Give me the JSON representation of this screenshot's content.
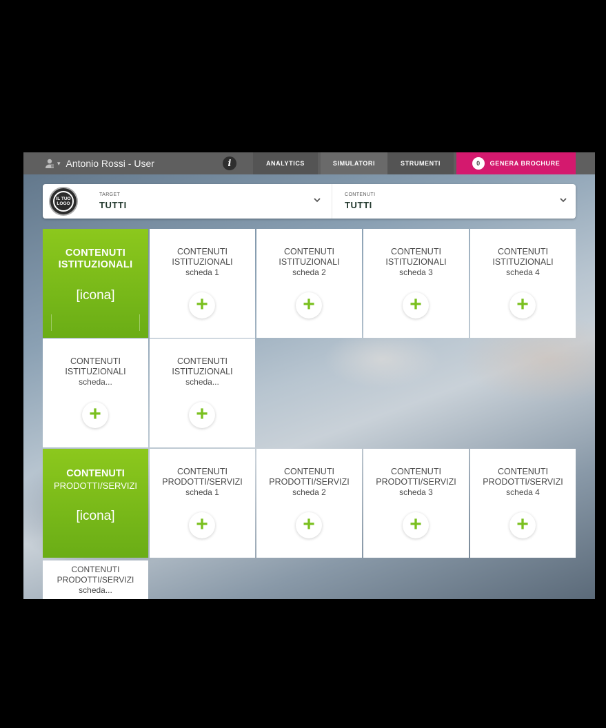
{
  "header": {
    "user_name": "Antonio Rossi - User",
    "user_caret": "▾",
    "info_icon": "i",
    "tabs": {
      "analytics": "ANALYTICS",
      "simulatori": "SIMULATORI",
      "strumenti": "STRUMENTI",
      "brochure": "GENERA BROCHURE"
    },
    "brochure_count": "0",
    "brochure_color": "#d4196e"
  },
  "filters": {
    "logo_line1": "IL TUO",
    "logo_line2": "LOGO",
    "target_label": "TARGET",
    "target_value": "TUTTI",
    "contenuti_label": "CONTENUTI",
    "contenuti_value": "TUTTI"
  },
  "sections": {
    "istituzionali": {
      "title_line1": "CONTENUTI",
      "title_line2": "ISTITUZIONALI",
      "icon_placeholder": "[icona]",
      "cards": [
        {
          "line1": "CONTENUTI",
          "line2": "ISTITUZIONALI",
          "line3": "scheda 1"
        },
        {
          "line1": "CONTENUTI",
          "line2": "ISTITUZIONALI",
          "line3": "scheda 2"
        },
        {
          "line1": "CONTENUTI",
          "line2": "ISTITUZIONALI",
          "line3": "scheda 3"
        },
        {
          "line1": "CONTENUTI",
          "line2": "ISTITUZIONALI",
          "line3": "scheda 4"
        },
        {
          "line1": "CONTENUTI",
          "line2": "ISTITUZIONALI",
          "line3": "scheda..."
        },
        {
          "line1": "CONTENUTI",
          "line2": "ISTITUZIONALI",
          "line3": "scheda..."
        }
      ]
    },
    "prodotti": {
      "title_line1": "CONTENUTI",
      "title_line2": "PRODOTTI/SERVIZI",
      "icon_placeholder": "[icona]",
      "cards": [
        {
          "line1": "CONTENUTI",
          "line2": "PRODOTTI/SERVIZI",
          "line3": "scheda 1"
        },
        {
          "line1": "CONTENUTI",
          "line2": "PRODOTTI/SERVIZI",
          "line3": "scheda 2"
        },
        {
          "line1": "CONTENUTI",
          "line2": "PRODOTTI/SERVIZI",
          "line3": "scheda 3"
        },
        {
          "line1": "CONTENUTI",
          "line2": "PRODOTTI/SERVIZI",
          "line3": "scheda 4"
        },
        {
          "line1": "CONTENUTI",
          "line2": "PRODOTTI/SERVIZI",
          "line3": "scheda..."
        }
      ]
    }
  },
  "add_symbol": "+",
  "accent_green": "#7ac01f",
  "icons": [
    "user-icon",
    "info-icon",
    "logo-icon",
    "chevron-down-icon",
    "plus-icon"
  ]
}
